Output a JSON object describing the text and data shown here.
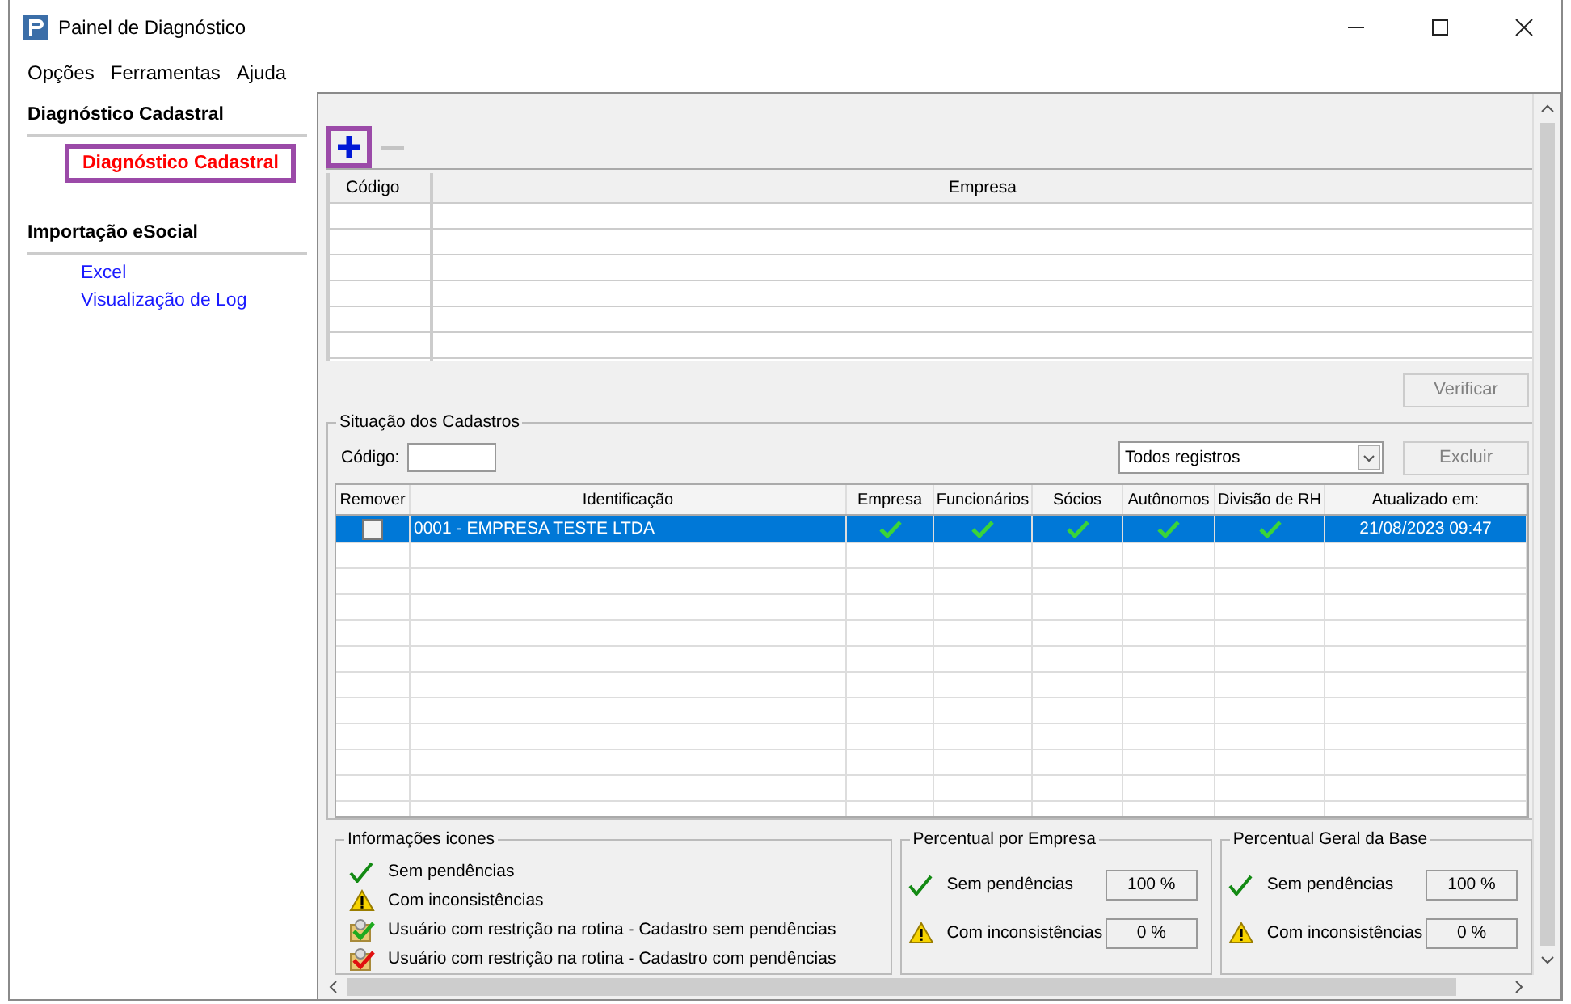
{
  "window": {
    "title": "Painel de Diagnóstico"
  },
  "menu": [
    "Opções",
    "Ferramentas",
    "Ajuda"
  ],
  "sidebar": [
    {
      "title": "Diagnóstico Cadastral",
      "items": [
        {
          "label": "Diagnóstico Cadastral",
          "highlighted": true
        }
      ]
    },
    {
      "title": "Importação eSocial",
      "items": [
        {
          "label": "Excel",
          "highlighted": false
        },
        {
          "label": "Visualização de Log",
          "highlighted": false
        }
      ]
    }
  ],
  "toolbar": [
    {
      "kind": "add",
      "highlighted": true,
      "disabled": false
    },
    {
      "kind": "remove",
      "highlighted": false,
      "disabled": true
    }
  ],
  "companies_table": {
    "columns": [
      "Código",
      "Empresa"
    ]
  },
  "verify_button": {
    "label": "Verificar",
    "disabled": true
  },
  "records": {
    "title": "Situação dos Cadastros",
    "code_label": "Código:",
    "filter": "Todos registros",
    "delete_button": {
      "label": "Excluir",
      "disabled": true
    },
    "columns": [
      "Remover",
      "Identificação",
      "Empresa",
      "Funcionários",
      "Sócios",
      "Autônomos",
      "Divisão de RH",
      "Atualizado em:"
    ],
    "rows": [
      {
        "selected": true,
        "remove": false,
        "identification": "0001 - EMPRESA TESTE LTDA",
        "statuses_ok": [
          true,
          true,
          true,
          true,
          true
        ],
        "updated": "21/08/2023 09:47"
      }
    ]
  },
  "legend": {
    "title": "Informações icones",
    "items": [
      {
        "kind": "check",
        "label": "Sem pendências"
      },
      {
        "kind": "warning",
        "label": "Com inconsistências"
      },
      {
        "kind": "user-ok",
        "label": "Usuário com restrição na rotina -  Cadastro sem pendências"
      },
      {
        "kind": "user-error",
        "label": "Usuário com restrição na rotina - Cadastro com pendências"
      }
    ]
  },
  "percent_groups": [
    {
      "title": "Percentual por Empresa",
      "rows": [
        {
          "kind": "check",
          "label": "Sem pendências",
          "value": "100 %"
        },
        {
          "kind": "warning",
          "label": "Com inconsistências",
          "value": "0 %"
        }
      ]
    },
    {
      "title": "Percentual Geral da Base",
      "rows": [
        {
          "kind": "check",
          "label": "Sem pendências",
          "value": "100 %"
        },
        {
          "kind": "warning",
          "label": "Com inconsistências",
          "value": "0 %"
        }
      ]
    }
  ]
}
